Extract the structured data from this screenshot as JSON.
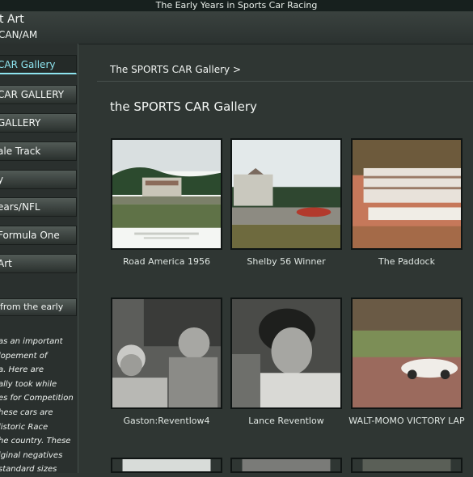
{
  "window": {
    "title": "The Early Years in Sports Car Racing"
  },
  "header": {
    "line1": "t Art",
    "line2": "CAN/AM"
  },
  "sidebar": {
    "items": [
      {
        "label": "CAR Gallery",
        "active": true
      },
      {
        "label": "CAR GALLERY"
      },
      {
        "label": "GALLERY"
      },
      {
        "label": "ale Track"
      },
      {
        "label": "y"
      },
      {
        "label": "ears/NFL"
      },
      {
        "label": "Formula One"
      },
      {
        "label": "Art"
      }
    ],
    "section_title": "from the early",
    "text_lines": [
      "as an important",
      "lopement of",
      "a. Here are",
      "ally took while",
      "es for Competition",
      "hese cars are",
      "listoric Race",
      "he country. These",
      "iginal negatives",
      "standard sizes"
    ]
  },
  "main": {
    "breadcrumb": "The SPORTS CAR Gallery >",
    "title": "the SPORTS CAR Gallery",
    "gallery": [
      {
        "caption": "Road America 1956",
        "image": "grandstand-photo"
      },
      {
        "caption": "Shelby 56 Winner",
        "image": "race-track-photo"
      },
      {
        "caption": "The Paddock",
        "image": "paddock-photo"
      },
      {
        "caption": "Gaston:Reventlow4",
        "image": "drivers-photo"
      },
      {
        "caption": "Lance Reventlow",
        "image": "portrait-photo"
      },
      {
        "caption": "WALT-MOMO VICTORY LAP",
        "image": "race-car-photo"
      }
    ]
  }
}
